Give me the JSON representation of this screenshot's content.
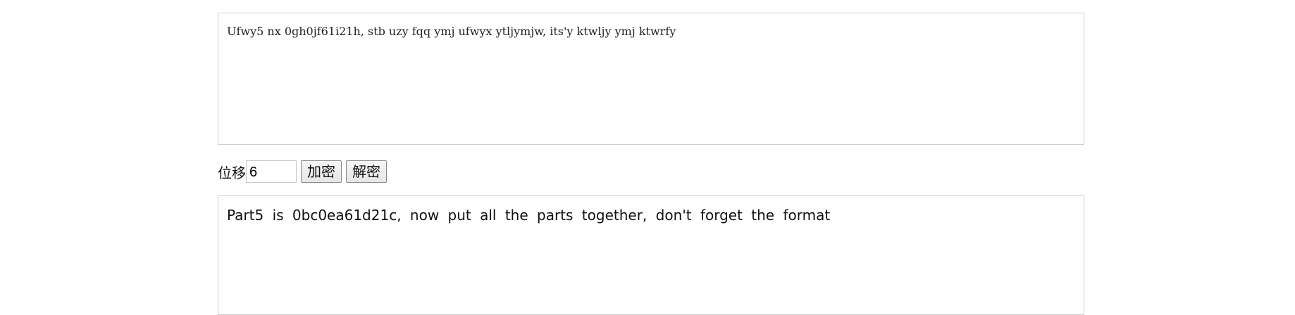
{
  "cipher": {
    "input_text": "Ufwy5 nx 0gh0jf61i21h, stb uzy fqq ymj ufwyx ytljymjw, its'y ktwljy ymj ktwrfy",
    "shift_label": "位移",
    "shift_value": "6",
    "encrypt_label": "加密",
    "decrypt_label": "解密",
    "output_text": "Part5 is 0bc0ea61d21c, now put all the parts together, don't forget the format"
  }
}
